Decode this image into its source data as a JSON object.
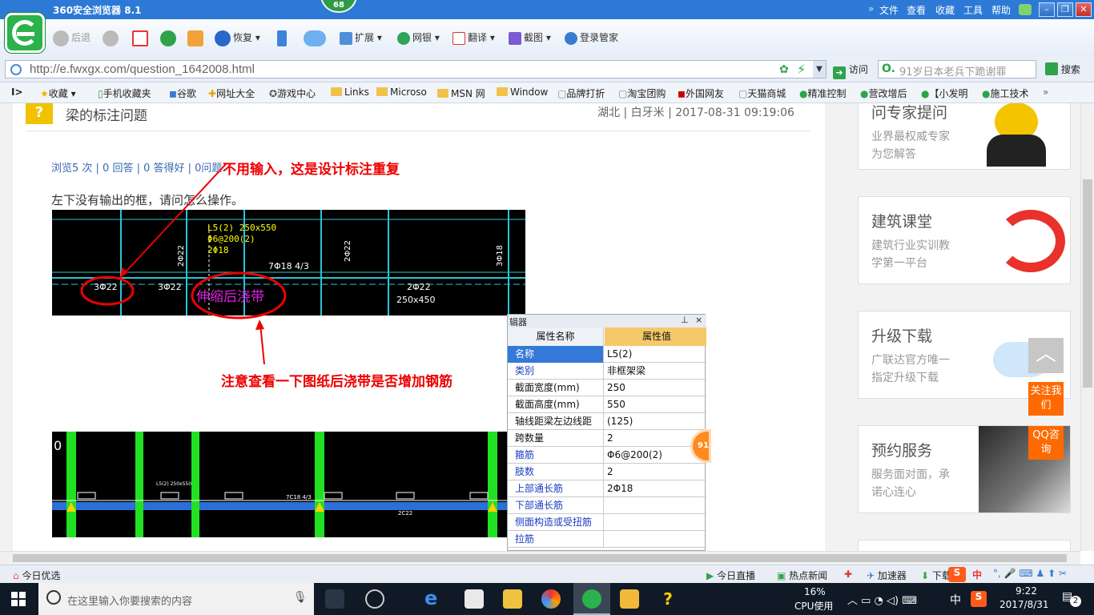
{
  "window": {
    "title": "360安全浏览器 8.1",
    "badge": "68",
    "menu": [
      "文件",
      "查看",
      "收藏",
      "工具",
      "帮助"
    ]
  },
  "toolbar": {
    "back": "后退",
    "restore": "恢复",
    "extend": "扩展",
    "netbank": "网银",
    "translate": "翻译",
    "screenshot": "截图",
    "login_manager": "登录管家"
  },
  "address": {
    "url": "http://e.fwxgx.com/question_1642008.html",
    "go": "访问",
    "search_placeholder": "91岁日本老兵下跪谢罪",
    "search_btn": "搜索"
  },
  "bookmarks": [
    "收藏",
    "手机收藏夹",
    "谷歌",
    "网址大全",
    "游戏中心",
    "Links",
    "Microso",
    "MSN 网",
    "Window",
    "品牌打折",
    "淘宝团购",
    "外国网友",
    "天猫商城",
    "精准控制",
    "营改增后",
    "【小发明",
    "施工技术"
  ],
  "question": {
    "icon": "?",
    "title": "梁的标注问题",
    "meta": "湖北 | 白牙米 | 2017-08-31 09:19:06",
    "stats": "浏览5 次 | 0 回答 | 0 答得好 | 0问题",
    "body": "左下没有输出的框，请问怎么操作。"
  },
  "annotations": {
    "note1": "不用输入，这是设计标注重复",
    "note2": "注意查看一下图纸后浇带是否增加钢筋",
    "circle_text": "伸缩后浇带"
  },
  "cad1": {
    "labels": [
      "L5(2) 250x550",
      "Φ6@200(2)",
      "2Φ18",
      "3Φ22",
      "3Φ22",
      "2Φ22",
      "250x450",
      "7Φ18 4/3",
      "2Φ22",
      "2Φ22",
      "3Φ18"
    ]
  },
  "cad2": {
    "zero": "0",
    "labels": [
      "L5(2) 250x550",
      "7C18 4/3",
      "2C22"
    ]
  },
  "panel": {
    "title": "辑器",
    "pin": "ꟷ",
    "close": "×",
    "header": [
      "属性名称",
      "属性值"
    ],
    "rows": [
      {
        "k": "名称",
        "v": "L5(2)",
        "blue": true,
        "sel": true
      },
      {
        "k": "类别",
        "v": "非框架梁",
        "blue": true
      },
      {
        "k": "截面宽度(mm)",
        "v": "250"
      },
      {
        "k": "截面高度(mm)",
        "v": "550"
      },
      {
        "k": "轴线距梁左边线距",
        "v": "(125)"
      },
      {
        "k": "跨数量",
        "v": "2"
      },
      {
        "k": "箍筋",
        "v": "Φ6@200(2)",
        "blue": true
      },
      {
        "k": "肢数",
        "v": "2",
        "blue": true
      },
      {
        "k": "上部通长筋",
        "v": "2Φ18",
        "blue": true
      },
      {
        "k": "下部通长筋",
        "v": "",
        "blue": true
      },
      {
        "k": "侧面构造或受扭筋",
        "v": "",
        "blue": true
      },
      {
        "k": "拉筋",
        "v": "",
        "blue": true
      }
    ]
  },
  "sidebar": {
    "cards": [
      {
        "title": "问专家提问",
        "s1": "业界最权威专家",
        "s2": "为您解答"
      },
      {
        "title": "建筑课堂",
        "s1": "建筑行业实训教",
        "s2": "学第一平台"
      },
      {
        "title": "升级下载",
        "s1": "广联达官方唯一",
        "s2": "指定升级下载"
      },
      {
        "title": "预约服务",
        "s1": "服务面对面，承",
        "s2": "诺心连心"
      }
    ],
    "follow": "关注我们",
    "qq": "QQ咨询",
    "top_arrow": "︿",
    "float_badge": "91"
  },
  "status": {
    "left": "今日优选",
    "live": "今日直播",
    "news": "热点新闻",
    "accel": "加速器",
    "download": "下载",
    "ime": "中"
  },
  "taskbar": {
    "search": "在这里输入你要搜索的内容",
    "cpu_pct": "16%",
    "cpu_label": "CPU使用",
    "lang": "中",
    "time": "9:22",
    "date": "2017/8/31",
    "notif": "2"
  },
  "colors": {
    "titlebar": "#2c79d6",
    "accent_green": "#2bb24c",
    "orange": "#ff6a00",
    "cad_bg": "#000000"
  }
}
